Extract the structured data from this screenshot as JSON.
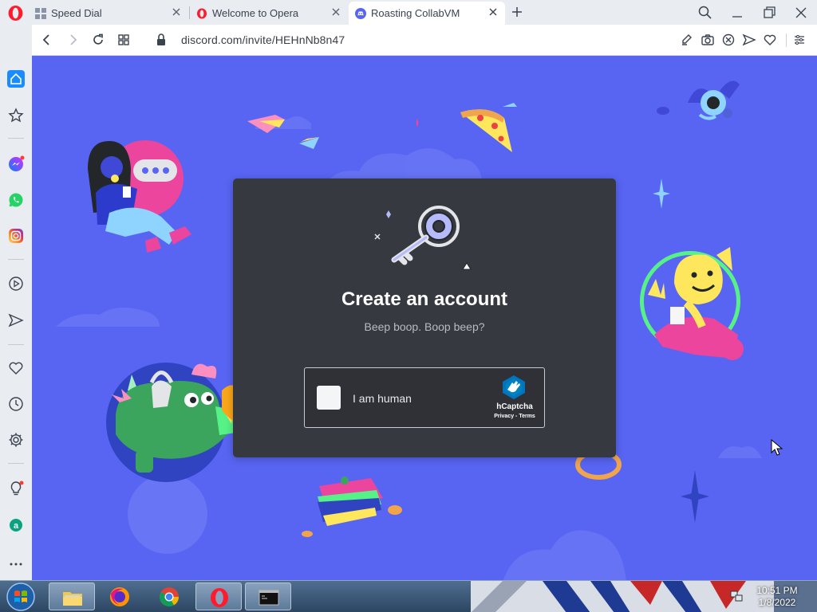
{
  "browser": {
    "tabs": [
      {
        "title": "Speed Dial",
        "active": false
      },
      {
        "title": "Welcome to Opera",
        "active": false
      },
      {
        "title": "Roasting CollabVM",
        "active": true
      }
    ],
    "url": "discord.com/invite/HEHnNb8n47"
  },
  "sidebar": {
    "items": [
      "home-icon",
      "star-icon",
      "messenger-icon",
      "whatsapp-icon",
      "instagram-icon",
      "player-icon",
      "send-icon",
      "heart-icon",
      "history-icon",
      "settings-icon",
      "lightbulb-icon",
      "extension-icon",
      "more-icon"
    ]
  },
  "modal": {
    "title": "Create an account",
    "subtitle": "Beep boop. Boop beep?",
    "captcha": {
      "label": "I am human",
      "brand": "hCaptcha",
      "links": "Privacy - Terms"
    }
  },
  "taskbar": {
    "time": "10:51 PM",
    "date": "1/8/2022"
  },
  "colors": {
    "discord_blurple": "#5865f2",
    "modal_bg": "#36393f",
    "opera_red": "#ff1b2d",
    "taskbar": "#2c4663"
  }
}
